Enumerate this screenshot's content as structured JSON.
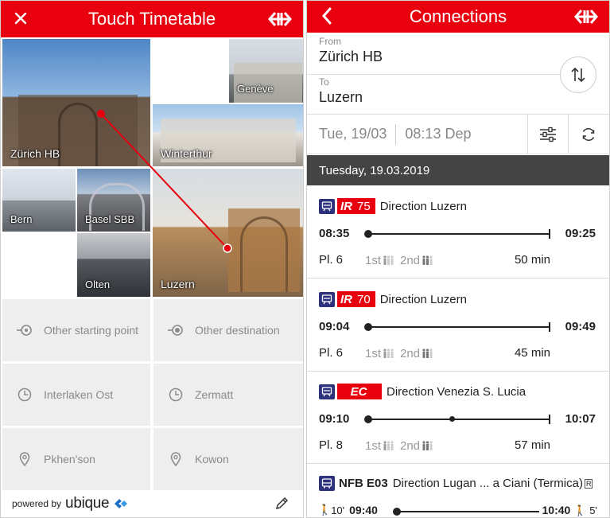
{
  "left_screen": {
    "title": "Touch Timetable",
    "close_icon": "close-icon",
    "sbb_logo": "sbb-logo-icon",
    "tiles": [
      {
        "name": "Zürich HB"
      },
      {
        "name": "Genève"
      },
      {
        "name": "Winterthur"
      },
      {
        "name": "Bern"
      },
      {
        "name": "Basel SBB"
      },
      {
        "name": "Luzern"
      },
      {
        "name": "Olten"
      }
    ],
    "options": [
      {
        "label": "Other starting point",
        "icon": "start-point-icon"
      },
      {
        "label": "Other destination",
        "icon": "destination-icon"
      },
      {
        "label": "Interlaken Ost",
        "icon": "clock-icon"
      },
      {
        "label": "Zermatt",
        "icon": "clock-icon"
      },
      {
        "label": "Pkhen'son",
        "icon": "location-pin-icon"
      },
      {
        "label": "Kowon",
        "icon": "location-pin-icon"
      }
    ],
    "footer": {
      "powered_by": "powered by",
      "brand": "ubique",
      "edit_icon": "pencil-icon"
    }
  },
  "right_screen": {
    "title": "Connections",
    "from_label": "From",
    "from_value": "Zürich HB",
    "to_label": "To",
    "to_value": "Luzern",
    "date": "Tue, 19/03",
    "time": "08:13 Dep",
    "day_header": "Tuesday, 19.03.2019",
    "connections": [
      {
        "product": "IR",
        "number": "75",
        "direction": "Direction Luzern",
        "dep": "08:35",
        "arr": "09:25",
        "platform": "Pl. 6",
        "first": "1st",
        "second": "2nd",
        "duration": "50 min"
      },
      {
        "product": "IR",
        "number": "70",
        "direction": "Direction Luzern",
        "dep": "09:04",
        "arr": "09:49",
        "platform": "Pl. 6",
        "first": "1st",
        "second": "2nd",
        "duration": "45 min"
      },
      {
        "product": "EC",
        "number": "",
        "direction": "Direction Venezia S. Lucia",
        "dep": "09:10",
        "arr": "10:07",
        "platform": "Pl. 8",
        "first": "1st",
        "second": "2nd",
        "duration": "57 min"
      }
    ],
    "bus": {
      "line": "NFB E03",
      "direction": "Direction Lugan ... a Ciani (Termica)",
      "reservation": "R",
      "walk_before": "10'",
      "dep": "09:40",
      "arr": "10:40",
      "walk_after": "5'"
    },
    "colors": {
      "accent": "#e8000f",
      "dark_header": "#444444",
      "train_blue": "#2d327d"
    }
  }
}
